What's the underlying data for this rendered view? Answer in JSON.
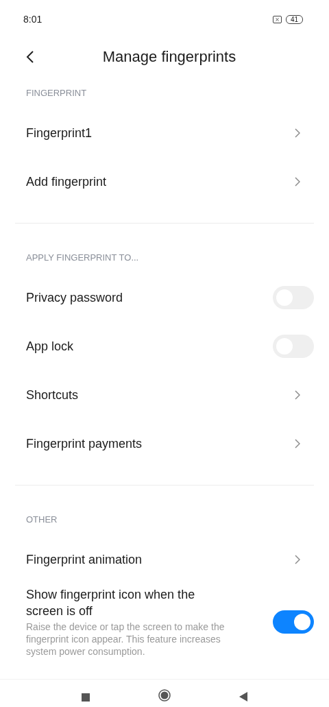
{
  "status_bar": {
    "time": "8:01",
    "battery": "41"
  },
  "header": {
    "title": "Manage fingerprints"
  },
  "sections": [
    {
      "label": "FINGERPRINT",
      "items": [
        {
          "kind": "link",
          "label": "Fingerprint1"
        },
        {
          "kind": "link",
          "label": "Add fingerprint"
        }
      ]
    },
    {
      "label": "APPLY FINGERPRINT TO...",
      "items": [
        {
          "kind": "switch",
          "label": "Privacy password",
          "on": false
        },
        {
          "kind": "switch",
          "label": "App lock",
          "on": false
        },
        {
          "kind": "link",
          "label": "Shortcuts"
        },
        {
          "kind": "link",
          "label": "Fingerprint payments"
        }
      ]
    },
    {
      "label": "OTHER",
      "items": [
        {
          "kind": "link",
          "label": "Fingerprint animation"
        },
        {
          "kind": "switch",
          "label": "Show fingerprint icon when the screen is off",
          "description": "Raise the device or tap the screen to make the fingerprint icon appear. This feature increases system power consumption.",
          "on": true
        }
      ]
    }
  ]
}
